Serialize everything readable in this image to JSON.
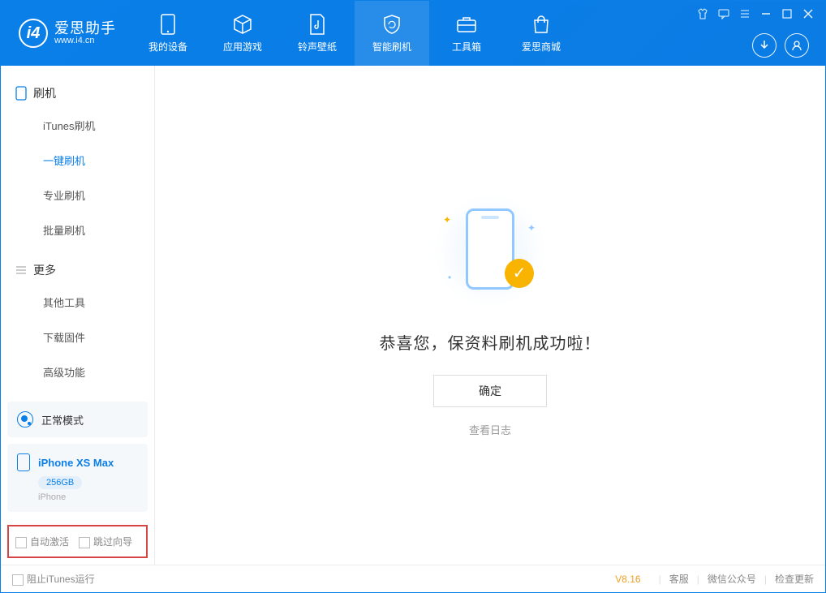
{
  "app": {
    "name": "爱思助手",
    "url": "www.i4.cn"
  },
  "tabs": [
    {
      "label": "我的设备"
    },
    {
      "label": "应用游戏"
    },
    {
      "label": "铃声壁纸"
    },
    {
      "label": "智能刷机"
    },
    {
      "label": "工具箱"
    },
    {
      "label": "爱思商城"
    }
  ],
  "sidebar": {
    "group1_title": "刷机",
    "group1_items": [
      {
        "label": "iTunes刷机"
      },
      {
        "label": "一键刷机"
      },
      {
        "label": "专业刷机"
      },
      {
        "label": "批量刷机"
      }
    ],
    "group2_title": "更多",
    "group2_items": [
      {
        "label": "其他工具"
      },
      {
        "label": "下载固件"
      },
      {
        "label": "高级功能"
      }
    ]
  },
  "mode": {
    "label": "正常模式"
  },
  "device": {
    "name": "iPhone XS Max",
    "capacity": "256GB",
    "type": "iPhone"
  },
  "bottom_options": {
    "auto_activate": "自动激活",
    "skip_wizard": "跳过向导"
  },
  "main": {
    "success_text": "恭喜您，保资料刷机成功啦！",
    "confirm_btn": "确定",
    "view_log": "查看日志"
  },
  "footer": {
    "block_itunes": "阻止iTunes运行",
    "version": "V8.16",
    "links": [
      "客服",
      "微信公众号",
      "检查更新"
    ]
  }
}
